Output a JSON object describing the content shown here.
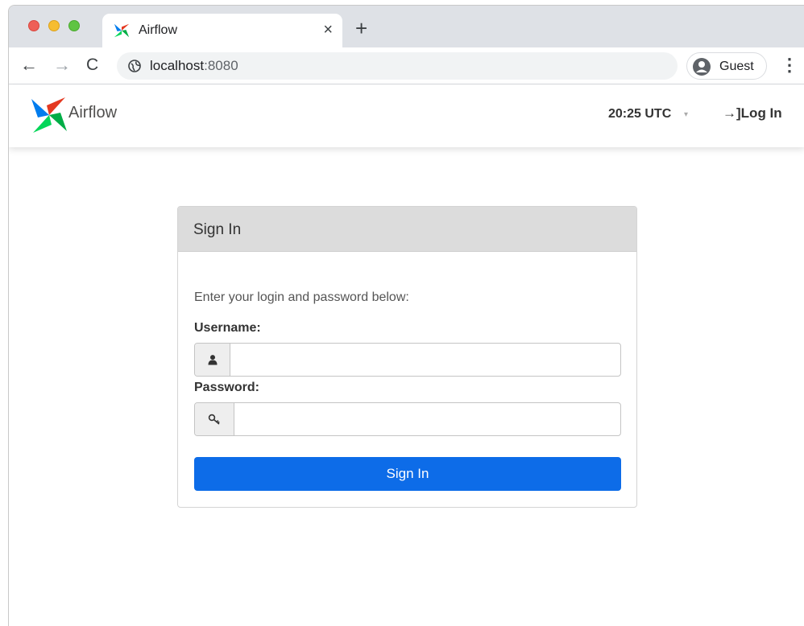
{
  "browser": {
    "tab": {
      "title": "Airflow",
      "close_glyph": "×"
    },
    "new_tab_glyph": "+",
    "nav": {
      "back_glyph": "←",
      "forward_glyph": "→",
      "reload_glyph": "C"
    },
    "address": {
      "host": "localhost",
      "port": ":8080"
    },
    "profile": {
      "label": "Guest"
    },
    "menu_glyph": "⋮"
  },
  "navbar": {
    "brand": "Airflow",
    "clock": "20:25 UTC",
    "clock_caret": "▾",
    "login": {
      "arrow_glyph": "→]",
      "label": "Log In"
    }
  },
  "signin": {
    "title": "Sign In",
    "lead": "Enter your login and password below:",
    "username_label": "Username:",
    "username_value": "",
    "password_label": "Password:",
    "password_value": "",
    "submit_label": "Sign In"
  },
  "colors": {
    "primary_button": "#0d6ce8",
    "panel_header": "#dcdcdc",
    "tabstrip": "#dee1e6",
    "traffic_red": "#ee5f57",
    "traffic_yellow": "#f6bd31",
    "traffic_green": "#5fc442"
  },
  "icons": {
    "favicon": "airflow-pinwheel-icon",
    "address": "globe-icon",
    "profile": "user-circle-icon",
    "username_addon": "user-icon",
    "password_addon": "key-icon"
  }
}
